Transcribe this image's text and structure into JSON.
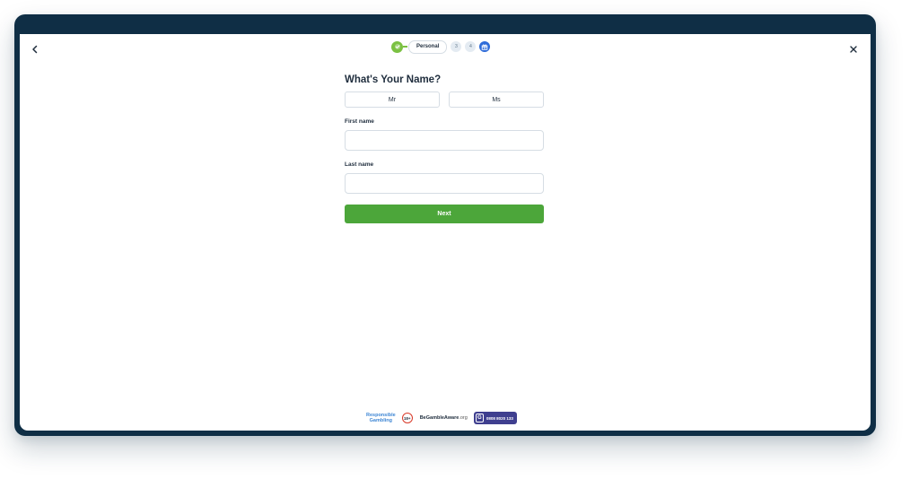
{
  "nav": {
    "back_icon": "chevron-left-icon",
    "close_icon": "close-icon"
  },
  "progress": {
    "completed_icon": "check-icon",
    "current_step_label": "Personal",
    "steps": [
      "3",
      "4"
    ],
    "final_icon": "gift-icon"
  },
  "form": {
    "title": "What's Your Name?",
    "title_options": [
      "Mr",
      "Ms"
    ],
    "first_name": {
      "label": "First name",
      "value": "",
      "placeholder": ""
    },
    "last_name": {
      "label": "Last name",
      "value": "",
      "placeholder": ""
    },
    "next_label": "Next"
  },
  "footer": {
    "responsible_line1": "Responsible",
    "responsible_line2": "Gambling",
    "age_badge": "18+",
    "begambleaware_bold": "BeGambleAware",
    "begambleaware_suffix": ".org",
    "gamcare_initial": "G",
    "gamcare_phone": "0808 8020 133"
  },
  "colors": {
    "frame": "#0f2e45",
    "primary_green": "#4ca63a",
    "step_done": "#7bc142",
    "step_final": "#2e6bd9",
    "responsible_blue": "#3e86d4",
    "gamcare_purple": "#3f3f8f"
  }
}
